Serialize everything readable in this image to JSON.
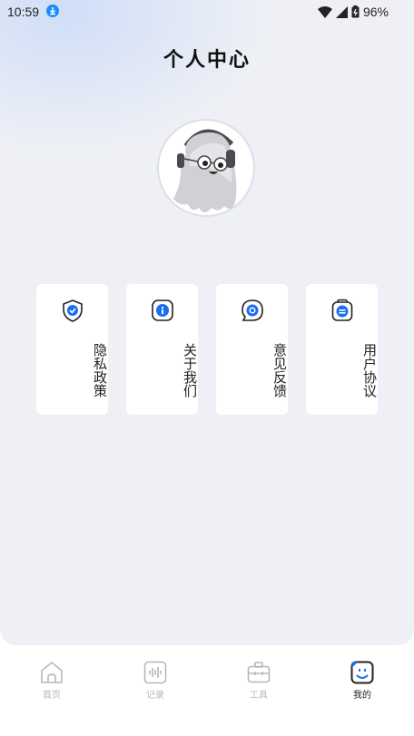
{
  "status_bar": {
    "time": "10:59",
    "battery": "96%"
  },
  "header": {
    "title": "个人中心"
  },
  "menu": [
    {
      "label": "隐私政策",
      "icon": "shield-check-icon"
    },
    {
      "label": "关于我们",
      "icon": "info-icon"
    },
    {
      "label": "意见反馈",
      "icon": "feedback-bubble-icon"
    },
    {
      "label": "用户协议",
      "icon": "agreement-icon"
    }
  ],
  "tabs": [
    {
      "label": "首页",
      "icon": "home-icon",
      "active": false
    },
    {
      "label": "记录",
      "icon": "waveform-icon",
      "active": false
    },
    {
      "label": "工具",
      "icon": "toolbox-icon",
      "active": false
    },
    {
      "label": "我的",
      "icon": "profile-face-icon",
      "active": true
    }
  ],
  "colors": {
    "accent": "#1a6ff0",
    "background": "#eef0f5",
    "card": "#ffffff",
    "inactive_tab": "#b5b8bf"
  }
}
